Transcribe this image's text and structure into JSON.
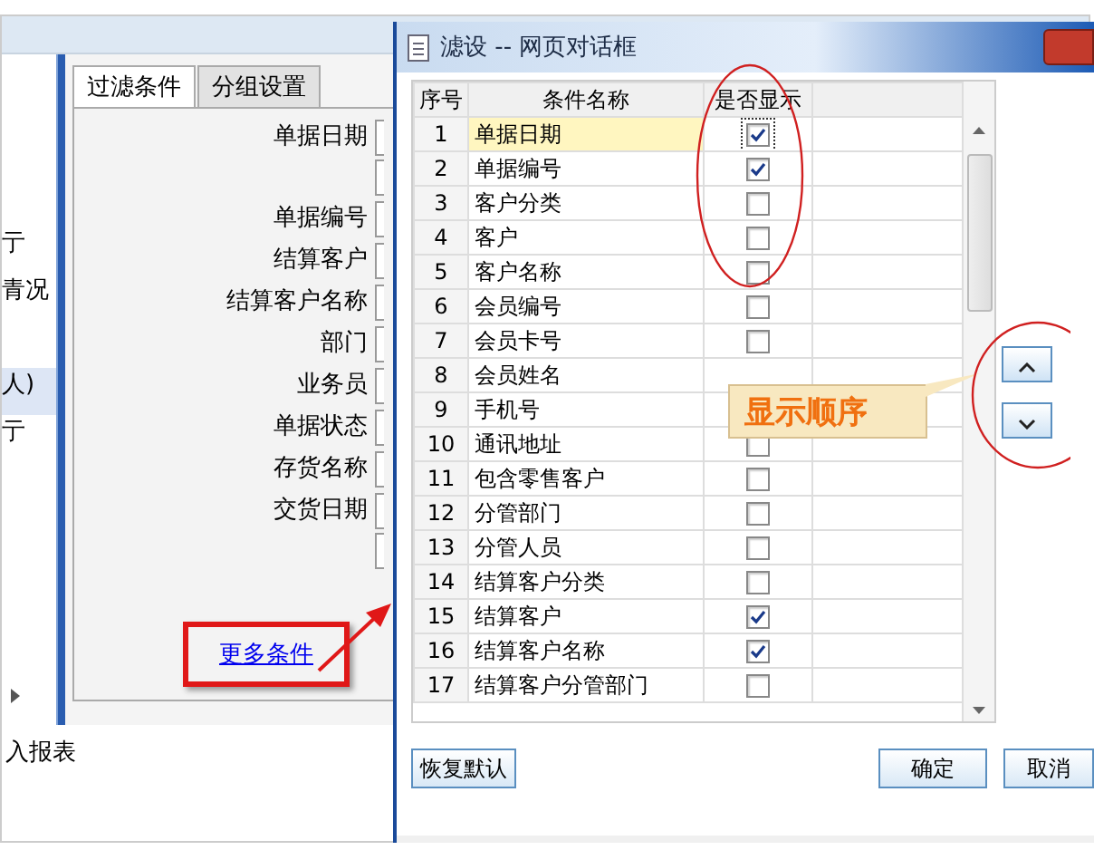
{
  "background_window": {
    "side_fragments": [
      "亍",
      "青况",
      "人)",
      "亍"
    ],
    "tabs": [
      {
        "label": "过滤条件",
        "selected": true
      },
      {
        "label": "分组设置",
        "selected": false
      }
    ],
    "fields": [
      {
        "label": "单据日期",
        "kind": "double"
      },
      {
        "label": "单据编号",
        "kind": "single"
      },
      {
        "label": "结算客户",
        "kind": "single"
      },
      {
        "label": "结算客户名称",
        "kind": "single"
      },
      {
        "label": "部门",
        "kind": "single"
      },
      {
        "label": "业务员",
        "kind": "single"
      },
      {
        "label": "单据状态",
        "kind": "single"
      },
      {
        "label": "存货名称",
        "kind": "single"
      },
      {
        "label": "交货日期",
        "kind": "double"
      }
    ],
    "more_link": "更多条件",
    "footer_text": "入报表"
  },
  "dialog": {
    "title": "滤设 -- 网页对话框",
    "columns": [
      "序号",
      "条件名称",
      "是否显示"
    ],
    "rows": [
      {
        "index": "1",
        "name": "单据日期",
        "shown": true,
        "selected": true
      },
      {
        "index": "2",
        "name": "单据编号",
        "shown": true,
        "selected": false
      },
      {
        "index": "3",
        "name": "客户分类",
        "shown": false,
        "selected": false
      },
      {
        "index": "4",
        "name": "客户",
        "shown": false,
        "selected": false
      },
      {
        "index": "5",
        "name": "客户名称",
        "shown": false,
        "selected": false
      },
      {
        "index": "6",
        "name": "会员编号",
        "shown": false,
        "selected": false
      },
      {
        "index": "7",
        "name": "会员卡号",
        "shown": false,
        "selected": false
      },
      {
        "index": "8",
        "name": "会员姓名",
        "selected": false
      },
      {
        "index": "9",
        "name": "手机号",
        "selected": false
      },
      {
        "index": "10",
        "name": "通讯地址",
        "shown": false,
        "selected": false
      },
      {
        "index": "11",
        "name": "包含零售客户",
        "shown": false,
        "selected": false
      },
      {
        "index": "12",
        "name": "分管部门",
        "shown": false,
        "selected": false
      },
      {
        "index": "13",
        "name": "分管人员",
        "shown": false,
        "selected": false
      },
      {
        "index": "14",
        "name": "结算客户分类",
        "shown": false,
        "selected": false
      },
      {
        "index": "15",
        "name": "结算客户",
        "shown": true,
        "selected": false
      },
      {
        "index": "16",
        "name": "结算客户名称",
        "shown": true,
        "selected": false
      },
      {
        "index": "17",
        "name": "结算客户分管部门",
        "shown": false,
        "selected": false
      }
    ],
    "order_tooltip": "显示顺序",
    "buttons": [
      {
        "label": "恢复默认",
        "kind": "left"
      },
      {
        "label": "确定",
        "kind": "right"
      },
      {
        "label": "取消",
        "kind": "right"
      }
    ]
  }
}
